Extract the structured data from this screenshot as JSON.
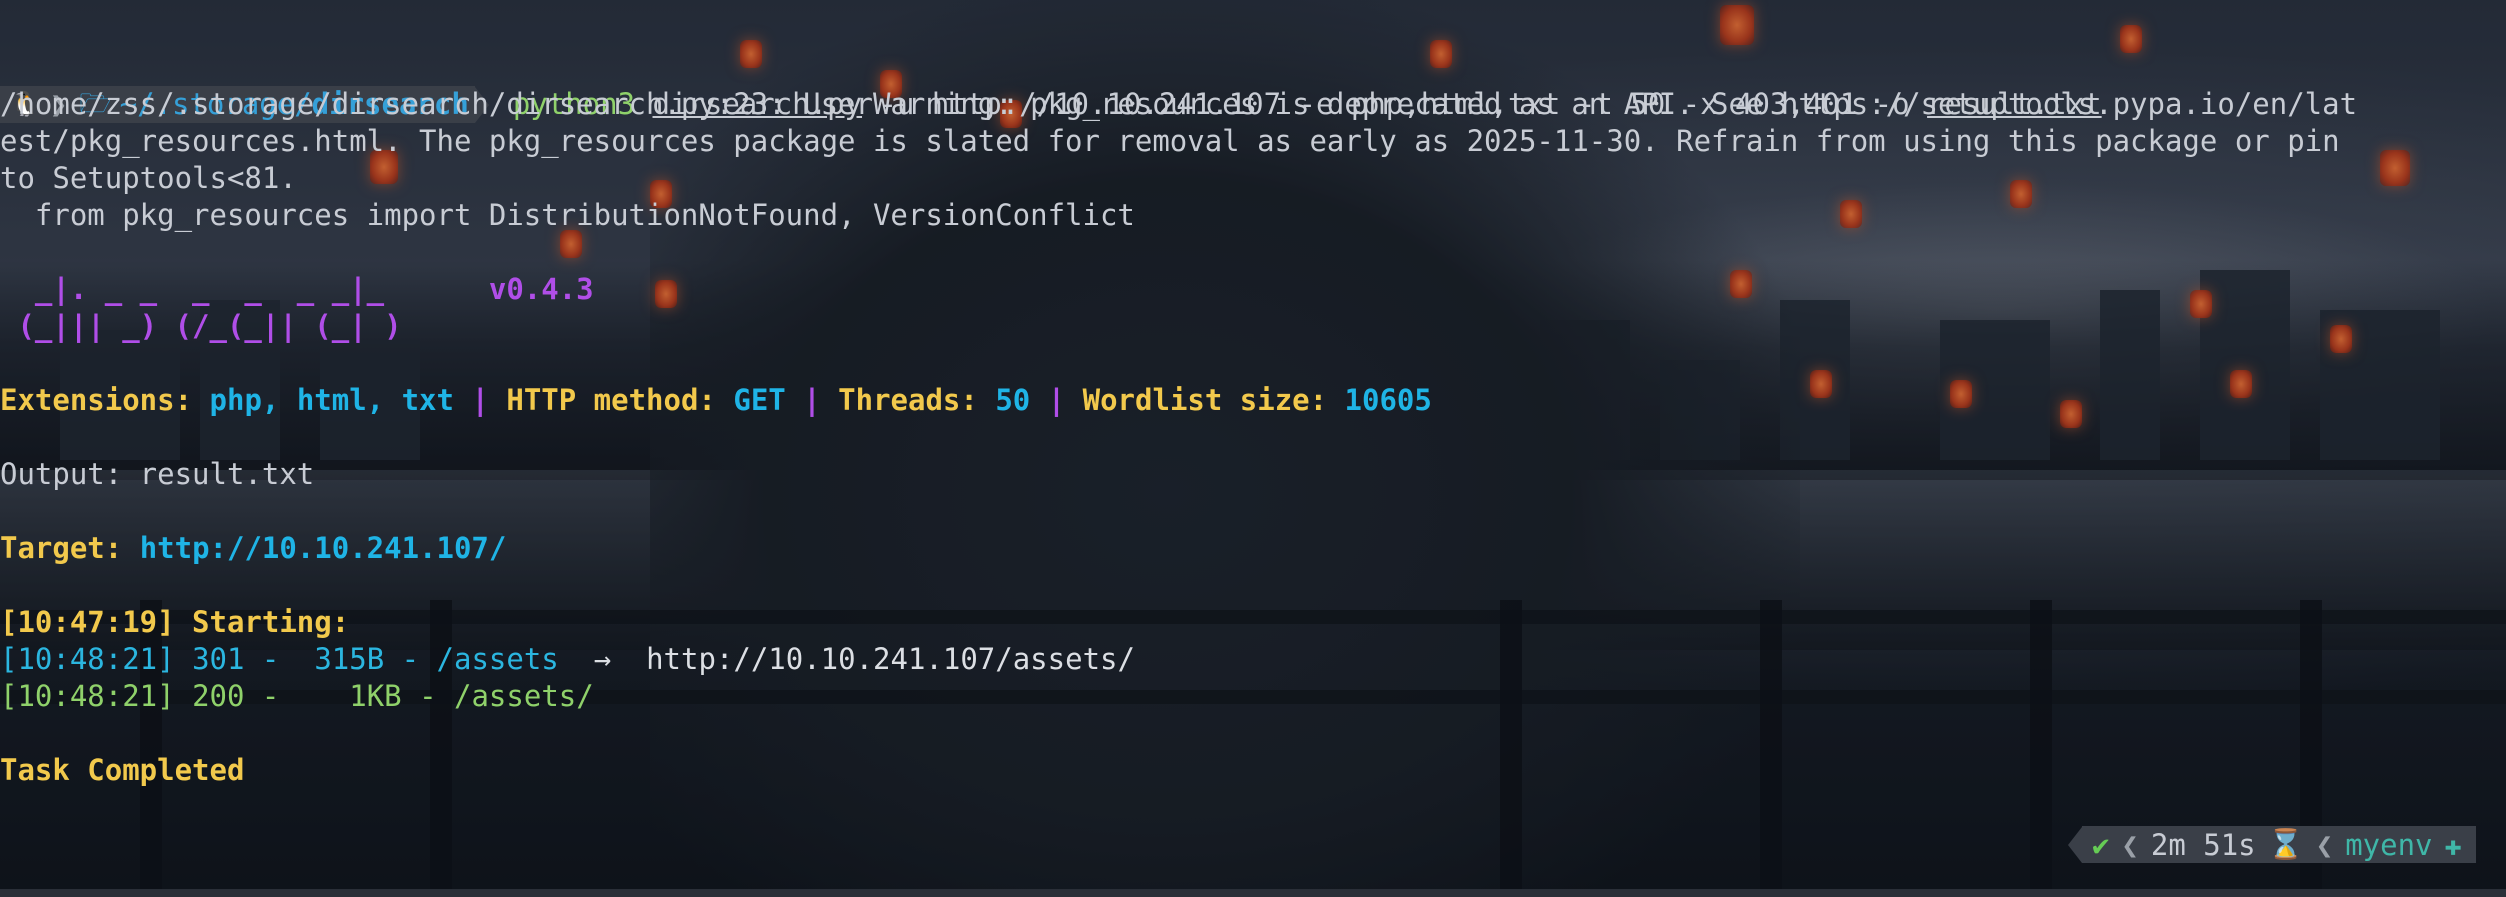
{
  "prompt": {
    "path_prefix": "~/.storage/",
    "path_dir": "dirsearch",
    "os_icon": "tux-icon",
    "folder_icon": "folder-icon"
  },
  "command": {
    "program": "python3",
    "script": "dirsearch.py",
    "args_mid": " -u http://10.10.241.107 -e php,html,txt -t 50 -x 403,401 -o ",
    "output_file": "result.txt"
  },
  "warning": {
    "line1": "/home/zss/.storage/dirsearch/dirsearch.py:23: UserWarning: pkg_resources is deprecated as an API. See https://setuptools.pypa.io/en/lat",
    "line2": "est/pkg_resources.html. The pkg_resources package is slated for removal as early as 2025-11-30. Refrain from using this package or pin",
    "line3": "to Setuptools<81.",
    "line4": "  from pkg_resources import DistributionNotFound, VersionConflict"
  },
  "banner": {
    "art1": "  _|. _ _  _  _  _ _|_",
    "art2": " (_||| _) (/_(_|| (_| )",
    "version": "v0.4.3"
  },
  "config": {
    "ext_label": "Extensions:",
    "ext_value": "php, html, txt",
    "sep": "|",
    "method_label": "HTTP method:",
    "method_value": "GET",
    "threads_label": "Threads:",
    "threads_value": "50",
    "wordlist_label": "Wordlist size:",
    "wordlist_value": "10605"
  },
  "output_line": "Output: result.txt",
  "target": {
    "label": "Target:",
    "url": "http://10.10.241.107/"
  },
  "starting": "[10:47:19] Starting:",
  "results": [
    {
      "time": "[10:48:21]",
      "status": "301",
      "size": "315B",
      "path": "/assets",
      "arrow": "->",
      "redirect": "http://10.10.241.107/assets/"
    },
    {
      "time": "[10:48:21]",
      "status": "200",
      "size": "1KB",
      "path": "/assets/"
    }
  ],
  "completed": "Task Completed",
  "rprompt": {
    "check": "✔",
    "duration": "2m 51s",
    "env": "myenv",
    "glass_icon": "hourglass-icon",
    "python_icon": "python-icon"
  },
  "colors": {
    "green": "#8fd16a",
    "blue": "#1fb4e6",
    "yellow": "#f2c94c",
    "purple": "#b04ee8",
    "teal": "#3fb7a8"
  }
}
